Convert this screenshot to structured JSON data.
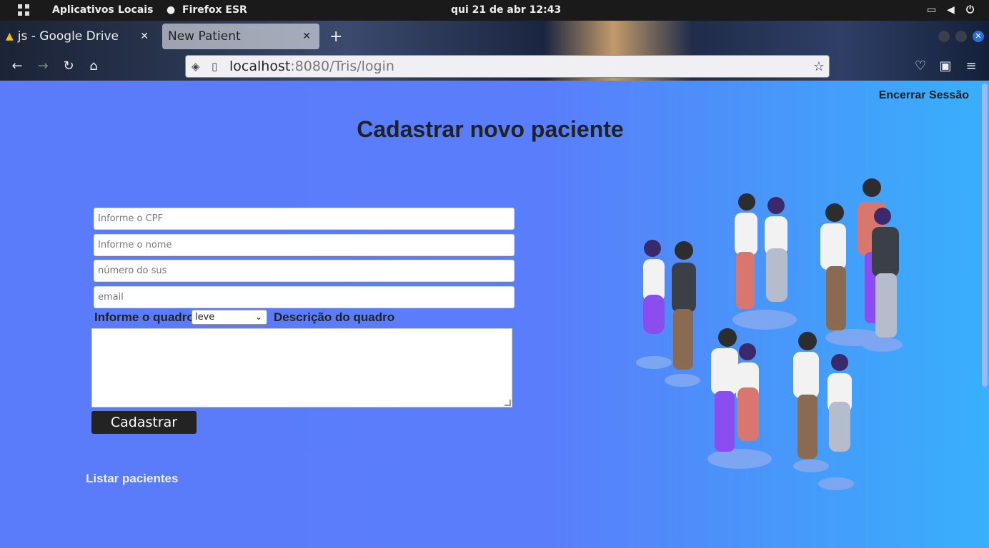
{
  "system_bar": {
    "apps_label": "Aplicativos",
    "places_label": "Locais",
    "active_app": "Firefox ESR",
    "datetime": "qui 21 de abr  12:43"
  },
  "browser": {
    "tabs": [
      {
        "label": "js - Google Drive",
        "active": false
      },
      {
        "label": "New Patient",
        "active": true
      }
    ],
    "url_host": "localhost",
    "url_rest": ":8080/Tris/login"
  },
  "page": {
    "logout_label": "Encerrar Sessão",
    "title": "Cadastrar novo paciente",
    "fields": {
      "cpf_placeholder": "Informe o CPF",
      "name_placeholder": "Informe o nome",
      "sus_placeholder": "número do sus",
      "email_placeholder": "email"
    },
    "quadro_label": "Informe o quadro",
    "quadro_value": "leve",
    "description_label": "Descrição do quadro",
    "submit_label": "Cadastrar",
    "list_link": "Listar pacientes"
  },
  "colors": {
    "page_gradient_start": "#5b7cfa",
    "page_gradient_end": "#38b0fb",
    "button_bg": "#232323"
  }
}
